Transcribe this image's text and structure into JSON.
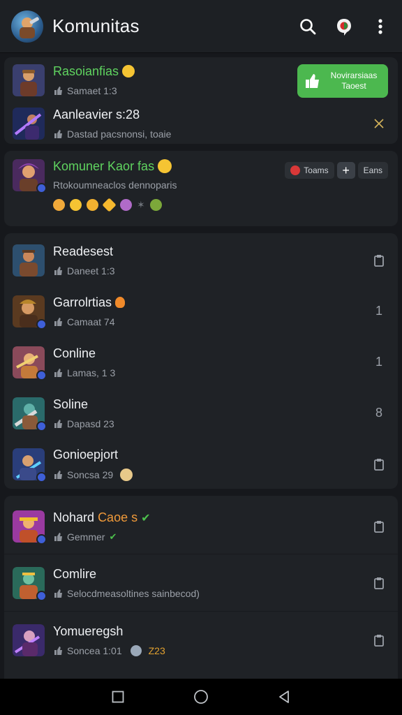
{
  "app": {
    "title": "Komunitas",
    "colors": {
      "background": "#16181c",
      "appbar": "#1d2024",
      "card": "#1f2226",
      "accent_green": "#4cb84f",
      "badge_blue": "#3e5fd8"
    }
  },
  "pinned": {
    "row1": {
      "name": "Rasoianfias",
      "sub": "Samaet 1:3",
      "button_label": "Novirarsiaas Taoest"
    },
    "row2": {
      "name": "Aanleavier s:28",
      "sub": "Dastad pacsnonsi, toaie"
    }
  },
  "featured": {
    "name": "Komuner Kaor fas",
    "sub": "Rtokoumneaclos dennoparis",
    "chip_left": "Toams",
    "chip_plus": "+",
    "chip_right": "Eans"
  },
  "list1": [
    {
      "name": "Readesest",
      "sub": "Daneet 1:3",
      "trail": ""
    },
    {
      "name": "Garrolrtias",
      "sub": "Camaat 74",
      "trail": "1"
    },
    {
      "name": "Conline",
      "sub": "Lamas, 1 3",
      "trail": "1"
    },
    {
      "name": "Soline",
      "sub": "Dapasd 23",
      "trail": "8"
    },
    {
      "name": "Gonioepjort",
      "sub": "Soncsa 29",
      "trail": ""
    }
  ],
  "list2": [
    {
      "name": "Nohard",
      "name_accent": "Caoe s",
      "sub": "Gemmer",
      "trail": ""
    },
    {
      "name": "Comlire",
      "sub": "Selocdmeasoltines sainbecod)",
      "trail": ""
    },
    {
      "name": "Yomueregsh",
      "sub": "Soncea 1:01",
      "sub_extra": "Z23",
      "trail": ""
    }
  ]
}
